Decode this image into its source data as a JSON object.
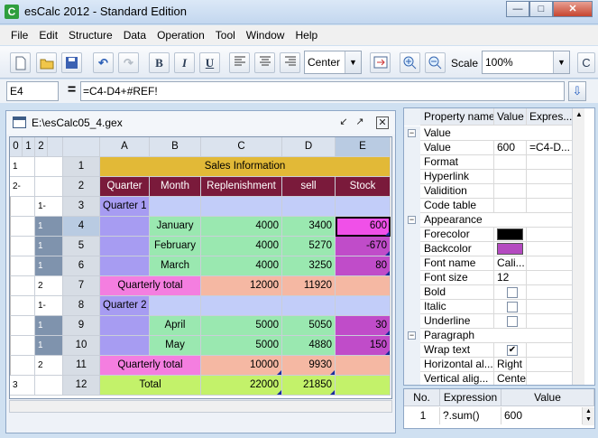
{
  "window": {
    "title": "esCalc 2012 - Standard Edition",
    "app_icon": "app-icon"
  },
  "menu": [
    "File",
    "Edit",
    "Structure",
    "Data",
    "Operation",
    "Tool",
    "Window",
    "Help"
  ],
  "toolbar": {
    "align_value": "Center",
    "scale_label": "Scale",
    "scale_value": "100%"
  },
  "formula": {
    "cell_ref": "E4",
    "eq": "=",
    "text": "=C4-D4+#REF!"
  },
  "document": {
    "title": "E:\\esCalc05_4.gex",
    "level_buttons": [
      "0",
      "1",
      "2"
    ],
    "col_headers": [
      "A",
      "B",
      "C",
      "D",
      "E"
    ],
    "outline_col1": [
      "1",
      "2-",
      "",
      "",
      "",
      "",
      "",
      "",
      "",
      "",
      "",
      "3"
    ],
    "outline_col2": [
      "",
      "",
      "1-",
      "1",
      "1",
      "1",
      "2",
      "1-",
      "1",
      "1",
      "2",
      ""
    ],
    "rows": [
      {
        "n": "1",
        "cells": [
          "Sales Information"
        ]
      },
      {
        "n": "2",
        "cells": [
          "Quarter",
          "Month",
          "Replenishment",
          "sell",
          "Stock"
        ]
      },
      {
        "n": "3",
        "cells": [
          "Quarter 1",
          "",
          "",
          "",
          ""
        ]
      },
      {
        "n": "4",
        "cells": [
          "",
          "January",
          "4000",
          "3400",
          "600"
        ]
      },
      {
        "n": "5",
        "cells": [
          "",
          "February",
          "4000",
          "5270",
          "-670"
        ]
      },
      {
        "n": "6",
        "cells": [
          "",
          "March",
          "4000",
          "3250",
          "80"
        ]
      },
      {
        "n": "7",
        "cells": [
          "Quarterly total",
          "",
          "12000",
          "11920",
          ""
        ]
      },
      {
        "n": "8",
        "cells": [
          "Quarter 2",
          "",
          "",
          "",
          ""
        ]
      },
      {
        "n": "9",
        "cells": [
          "",
          "April",
          "5000",
          "5050",
          "30"
        ]
      },
      {
        "n": "10",
        "cells": [
          "",
          "May",
          "5000",
          "4880",
          "150"
        ]
      },
      {
        "n": "11",
        "cells": [
          "Quarterly total",
          "",
          "10000",
          "9930",
          ""
        ]
      },
      {
        "n": "12",
        "cells": [
          "Total",
          "",
          "22000",
          "21850",
          ""
        ]
      }
    ]
  },
  "properties": {
    "headers": [
      "Property name",
      "Value",
      "Expres..."
    ],
    "rows": [
      {
        "kind": "group",
        "name": "Value"
      },
      {
        "kind": "prop",
        "name": "Value",
        "value": "600",
        "expr": "=C4-D..."
      },
      {
        "kind": "prop",
        "name": "Format",
        "value": "",
        "expr": ""
      },
      {
        "kind": "prop",
        "name": "Hyperlink",
        "value": "",
        "expr": ""
      },
      {
        "kind": "prop",
        "name": "Validition",
        "value": "",
        "expr": ""
      },
      {
        "kind": "prop",
        "name": "Code table",
        "value": "",
        "expr": ""
      },
      {
        "kind": "group",
        "name": "Appearance"
      },
      {
        "kind": "color",
        "name": "Forecolor",
        "value": "#000000"
      },
      {
        "kind": "color",
        "name": "Backcolor",
        "value": "#b44ac0"
      },
      {
        "kind": "prop",
        "name": "Font name",
        "value": "Cali...",
        "expr": ""
      },
      {
        "kind": "prop",
        "name": "Font size",
        "value": "12",
        "expr": ""
      },
      {
        "kind": "check",
        "name": "Bold",
        "checked": false
      },
      {
        "kind": "check",
        "name": "Italic",
        "checked": false
      },
      {
        "kind": "check",
        "name": "Underline",
        "checked": false
      },
      {
        "kind": "group",
        "name": "Paragraph"
      },
      {
        "kind": "check",
        "name": "Wrap text",
        "checked": true
      },
      {
        "kind": "prop",
        "name": "Horizontal al...",
        "value": "Right",
        "expr": ""
      },
      {
        "kind": "prop",
        "name": "Vertical alig...",
        "value": "Center",
        "expr": ""
      }
    ]
  },
  "expressions": {
    "headers": [
      "No.",
      "Expression",
      "Value"
    ],
    "rows": [
      {
        "no": "1",
        "expr": "?.sum()",
        "value": "600"
      }
    ]
  },
  "colors": {
    "gold": "#e2b937",
    "maroon": "#7a1a3b",
    "lavender": "#b3a4f3",
    "quarter_blue": "#a79cf2",
    "month_green": "#9ae8b0",
    "pink": "#f47ee0",
    "salmon": "#f5b8a3",
    "stock_purple": "#c04cc9",
    "selected_pink": "#f050e8",
    "total_lime": "#c3f26a"
  }
}
